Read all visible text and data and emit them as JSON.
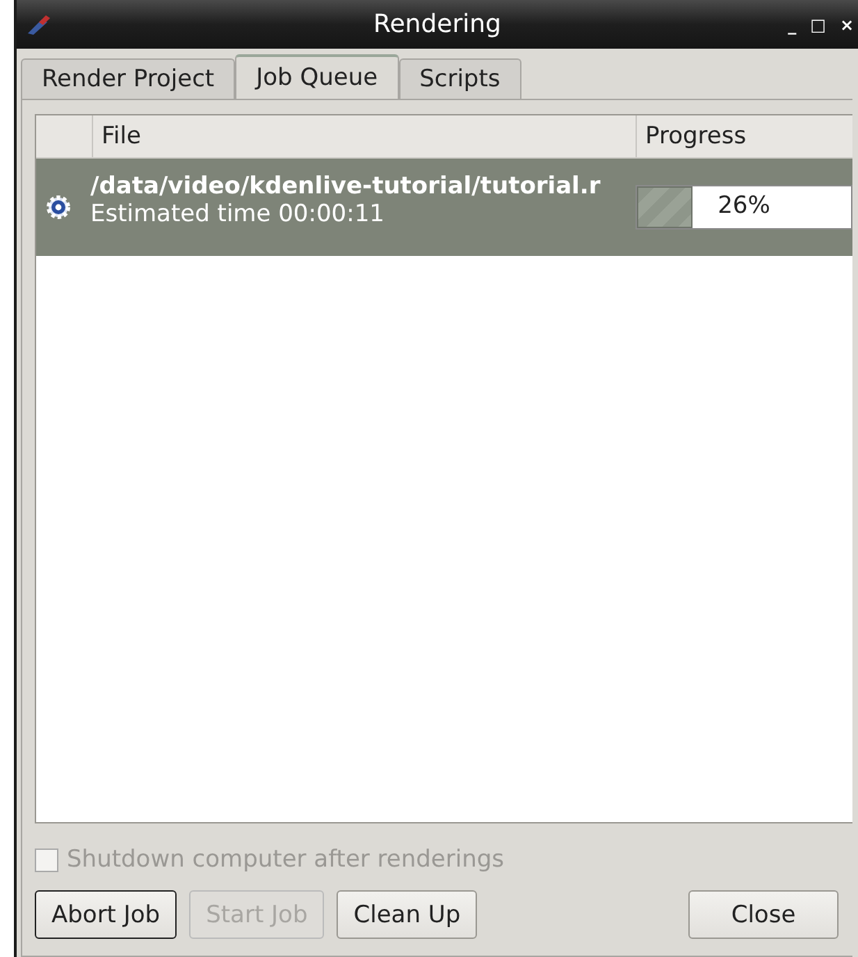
{
  "window": {
    "title": "Rendering",
    "controls": [
      "_",
      "□",
      "×"
    ]
  },
  "tabs": [
    {
      "label": "Render Project",
      "selected": false
    },
    {
      "label": "Job Queue",
      "selected": true
    },
    {
      "label": "Scripts",
      "selected": false
    }
  ],
  "table": {
    "columns": [
      "File",
      "Progress"
    ],
    "rows": [
      {
        "file": "/data/video/kdenlive-tutorial/tutorial.r",
        "status": "Estimated time 00:00:11",
        "level": 0.26,
        "reading": "26%",
        "selected": true
      }
    ]
  },
  "shutdown": {
    "label": "Shutdown computer after renderings",
    "checked": false,
    "disabled": true
  },
  "buttons": [
    {
      "label": "Abort Job",
      "disabled": false,
      "default": true
    },
    {
      "label": "Start Job",
      "disabled": true,
      "default": false
    },
    {
      "label": "Clean Up",
      "disabled": false,
      "default": false
    },
    {
      "label": "Close",
      "disabled": false,
      "default": false
    }
  ]
}
